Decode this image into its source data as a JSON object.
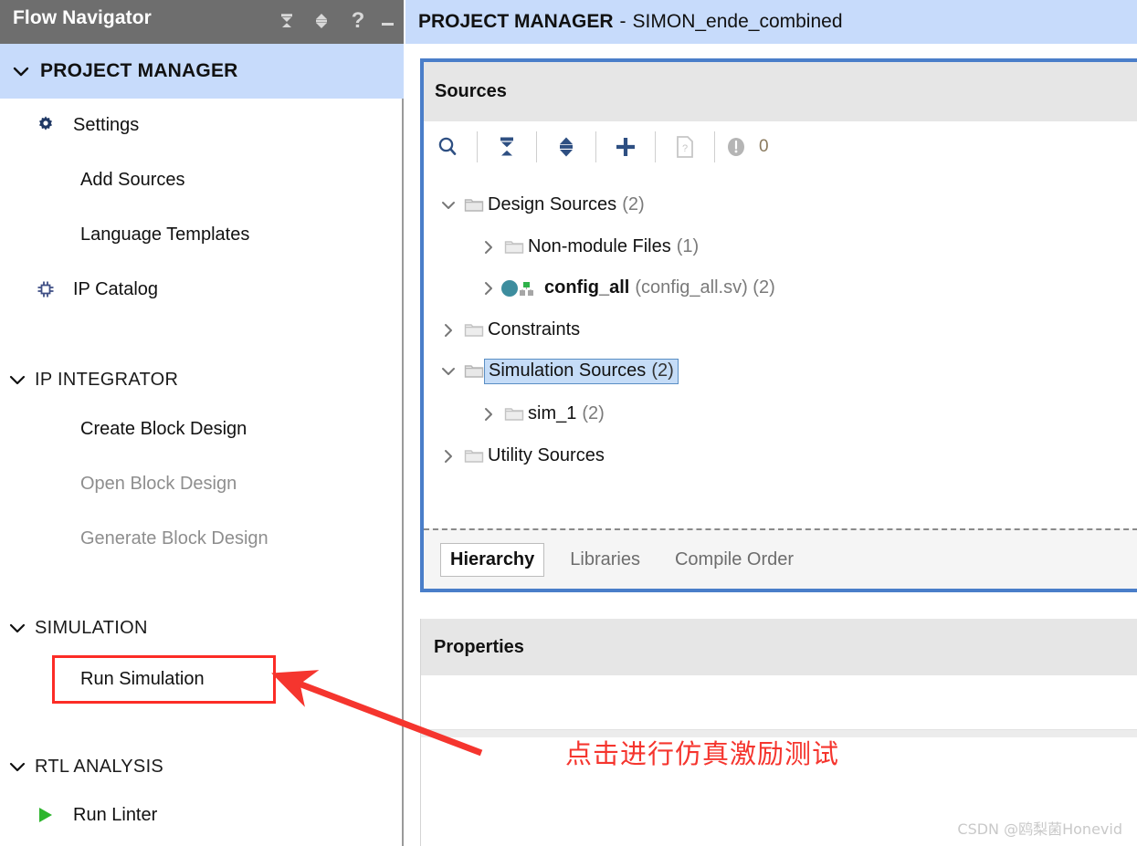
{
  "sidebar": {
    "title": "Flow Navigator",
    "titlebar_icons": [
      {
        "name": "collapse-all-icon",
        "glyph": "collapse"
      },
      {
        "name": "expand-collapse-icon",
        "glyph": "updown"
      },
      {
        "name": "help-icon",
        "glyph": "?"
      },
      {
        "name": "minimize-icon",
        "glyph": "minimize"
      }
    ],
    "sections": [
      {
        "label": "PROJECT MANAGER",
        "highlighted": true,
        "items": [
          {
            "label": "Settings",
            "icon": "gear-icon",
            "disabled": false
          },
          {
            "label": "Add Sources",
            "icon": null,
            "disabled": false
          },
          {
            "label": "Language Templates",
            "icon": null,
            "disabled": false
          },
          {
            "label": "IP Catalog",
            "icon": "ip-catalog-icon",
            "disabled": false
          }
        ]
      },
      {
        "label": "IP INTEGRATOR",
        "highlighted": false,
        "items": [
          {
            "label": "Create Block Design",
            "icon": null,
            "disabled": false
          },
          {
            "label": "Open Block Design",
            "icon": null,
            "disabled": true
          },
          {
            "label": "Generate Block Design",
            "icon": null,
            "disabled": true
          }
        ]
      },
      {
        "label": "SIMULATION",
        "highlighted": false,
        "items": [
          {
            "label": "Run Simulation",
            "icon": null,
            "disabled": false
          }
        ]
      },
      {
        "label": "RTL ANALYSIS",
        "highlighted": false,
        "items": [
          {
            "label": "Run Linter",
            "icon": "play-icon",
            "disabled": false
          }
        ]
      }
    ]
  },
  "main": {
    "header": {
      "title": "PROJECT MANAGER",
      "separator": "-",
      "project_name": "SIMON_ende_combined"
    },
    "sources_panel": {
      "title": "Sources",
      "toolbar": [
        {
          "name": "search-icon",
          "label": "search"
        },
        {
          "name": "collapse-all-icon",
          "label": "collapse all"
        },
        {
          "name": "expand-all-icon",
          "label": "expand all"
        },
        {
          "name": "add-sources-icon",
          "label": "add sources"
        },
        {
          "name": "report-icon",
          "label": "report"
        },
        {
          "name": "warning-icon",
          "label": "messages"
        }
      ],
      "badge_count": "0",
      "tree": [
        {
          "label": "Design Sources",
          "count": "(2)",
          "depth": 0,
          "expanded": true,
          "arrow": "down",
          "icon": "folder-icon",
          "selected": false,
          "bold": false
        },
        {
          "label": "Non-module Files",
          "count": "(1)",
          "depth": 1,
          "expanded": false,
          "arrow": "right",
          "icon": "folder-icon",
          "selected": false,
          "bold": false
        },
        {
          "label": "config_all",
          "count": "(config_all.sv) (2)",
          "depth": 1,
          "expanded": false,
          "arrow": "right",
          "icon": "module-icon",
          "selected": false,
          "bold": true
        },
        {
          "label": "Constraints",
          "count": "",
          "depth": 0,
          "expanded": false,
          "arrow": "right",
          "icon": "folder-icon",
          "selected": false,
          "bold": false
        },
        {
          "label": "Simulation Sources",
          "count": "(2)",
          "depth": 0,
          "expanded": true,
          "arrow": "down",
          "icon": "folder-icon",
          "selected": true,
          "bold": false
        },
        {
          "label": "sim_1",
          "count": "(2)",
          "depth": 1,
          "expanded": false,
          "arrow": "right",
          "icon": "folder-icon",
          "selected": false,
          "bold": false
        },
        {
          "label": "Utility Sources",
          "count": "",
          "depth": 0,
          "expanded": false,
          "arrow": "right",
          "icon": "folder-icon",
          "selected": false,
          "bold": false
        }
      ],
      "tabs": [
        {
          "label": "Hierarchy",
          "active": true
        },
        {
          "label": "Libraries",
          "active": false
        },
        {
          "label": "Compile Order",
          "active": false
        }
      ]
    },
    "properties_panel": {
      "title": "Properties"
    }
  },
  "annotation": {
    "note_text": "点击进行仿真激励测试",
    "highlight_target": "Run Simulation",
    "color": "#f5352e"
  },
  "watermark": {
    "text": "CSDN @鸥梨菌Honevid"
  },
  "colors": {
    "titlebar_bg": "#6e6e6e",
    "band_bg": "#c7dbfb",
    "panel_border": "#4a7ec9",
    "panel_header_bg": "#e6e6e6",
    "annotation_red": "#f5352e",
    "icon_blue": "#2e4f82",
    "module_teal": "#3d8d9e",
    "play_green": "#2db52d"
  }
}
